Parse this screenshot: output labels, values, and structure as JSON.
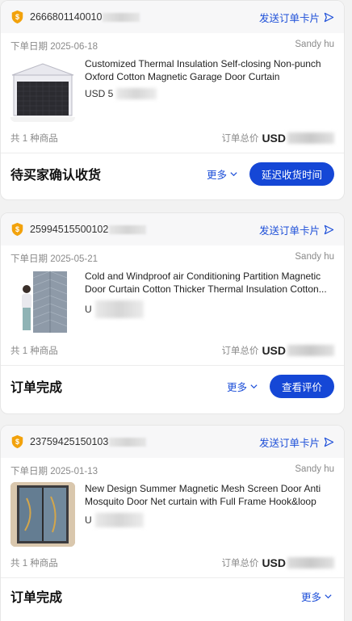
{
  "orders": [
    {
      "order_id": "2666801140010",
      "send_card_label": "发送订单卡片",
      "order_date_label": "下单日期",
      "order_date": "2025-06-18",
      "seller": "Sandy hu",
      "product_title": "Customized Thermal Insulation Self-closing Non-punch Oxford Cotton Magnetic Garage Door Curtain",
      "price_prefix": "USD 5",
      "item_count": "共 1 种商品",
      "total_label": "订单总价",
      "total_currency": "USD",
      "status": "待买家确认收货",
      "more_label": "更多",
      "action_label": "延迟收货时间"
    },
    {
      "order_id": "25994515500102",
      "send_card_label": "发送订单卡片",
      "order_date_label": "下单日期",
      "order_date": "2025-05-21",
      "seller": "Sandy hu",
      "product_title": "Cold and Windproof air Conditioning Partition Magnetic Door Curtain Cotton Thicker Thermal Insulation Cotton...",
      "price_prefix": "U",
      "item_count": "共 1 种商品",
      "total_label": "订单总价",
      "total_currency": "USD",
      "status": "订单完成",
      "more_label": "更多",
      "action_label": "查看评价"
    },
    {
      "order_id": "23759425150103",
      "send_card_label": "发送订单卡片",
      "order_date_label": "下单日期",
      "order_date": "2025-01-13",
      "seller": "Sandy hu",
      "product_title": "New Design Summer Magnetic Mesh Screen Door Anti Mosquito Door Net curtain with Full Frame Hook&loop An...",
      "price_prefix": "U",
      "item_count": "共 1 种商品",
      "total_label": "订单总价",
      "total_currency": "USD",
      "status": "订单完成",
      "more_label": "更多",
      "action_label": ""
    }
  ],
  "icons": {
    "shield": "verified-shield-icon",
    "send": "send-arrow-icon",
    "chevron": "chevron-down-icon"
  },
  "colors": {
    "accent": "#1547d6",
    "link": "#1d4fd8",
    "shield": "#f2a20c"
  }
}
